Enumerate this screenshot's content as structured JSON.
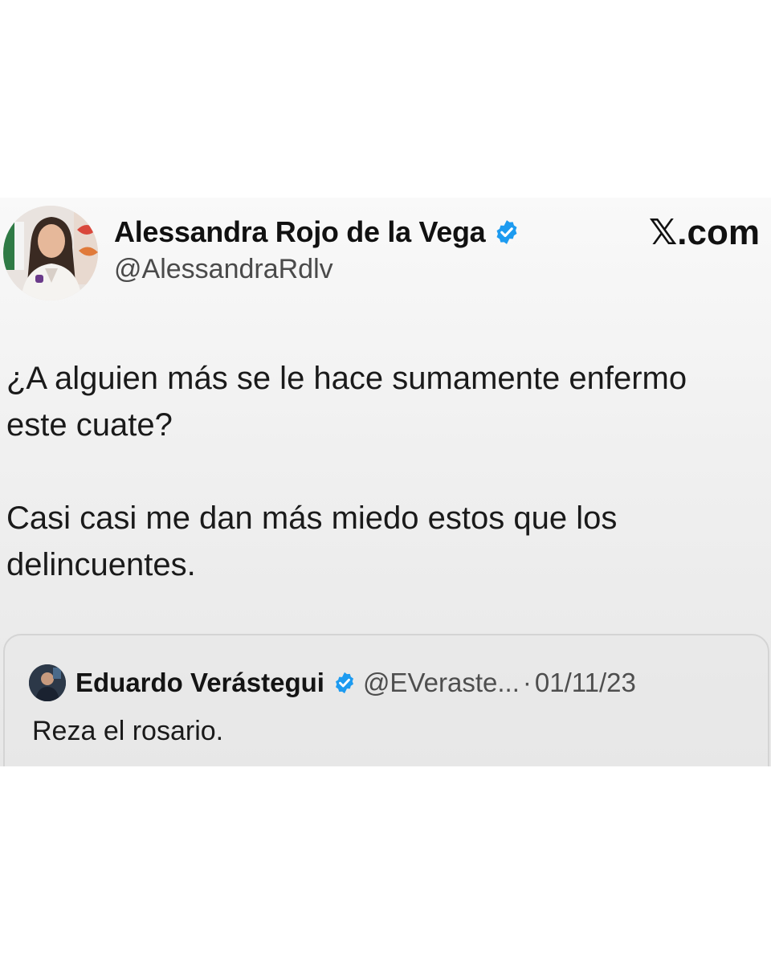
{
  "tweet": {
    "author_name": "Alessandra Rojo de la Vega",
    "author_handle": "@AlessandraRdlv",
    "verified_icon": "verified-badge-icon",
    "brand": "𝕏.com",
    "text_lines": [
      "¿A alguien más se le hace sumamente enfermo",
      "este cuate?",
      "Casi casi me dan más miedo estos que los",
      "delincuentes."
    ]
  },
  "quoted_tweet": {
    "author_name": "Eduardo Verástegui",
    "author_handle": "@EVeraste...",
    "separator": "·",
    "date": "01/11/23",
    "text": "Reza el rosario."
  },
  "colors": {
    "verified_blue": "#1d9bf0",
    "text_primary": "#111111",
    "text_secondary": "#4a4a4a"
  }
}
